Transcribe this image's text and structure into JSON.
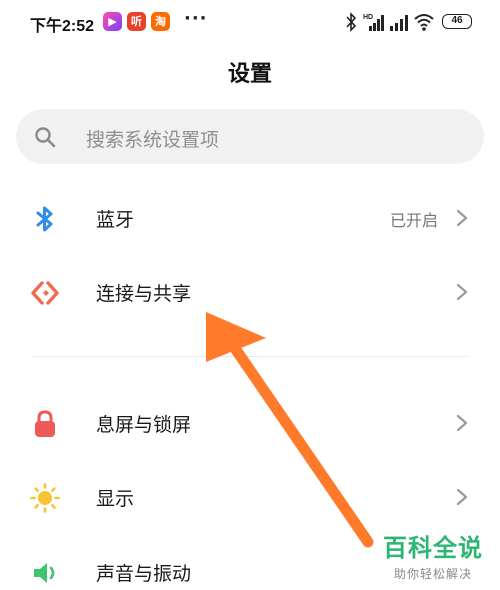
{
  "status_bar": {
    "time": "下午2:52",
    "apps": [
      {
        "name": "video-app-icon",
        "glyph": "▶"
      },
      {
        "name": "listen-app-icon",
        "glyph": "听"
      },
      {
        "name": "taobao-app-icon",
        "glyph": "淘"
      }
    ],
    "more": "···",
    "signal_tag": "HD",
    "battery": "46"
  },
  "title": "设置",
  "search": {
    "placeholder": "搜索系统设置项"
  },
  "settings": [
    {
      "label": "蓝牙",
      "value": "已开启",
      "icon": "bluetooth-icon",
      "color": "#2f8fe8"
    },
    {
      "label": "连接与共享",
      "icon": "connection-share-icon",
      "color": "#f06b52"
    },
    {
      "label": "息屏与锁屏",
      "icon": "lock-icon",
      "color": "#ee5a5a"
    },
    {
      "label": "显示",
      "icon": "sun-icon",
      "color": "#f7c531"
    },
    {
      "label": "声音与振动",
      "icon": "speaker-icon",
      "color": "#3ec46d"
    }
  ],
  "annotation": {
    "arrow_color": "#ff7a2a"
  },
  "watermark": {
    "title": "百科全说",
    "subtitle": "助你轻松解决",
    "color": "#2bb673"
  }
}
